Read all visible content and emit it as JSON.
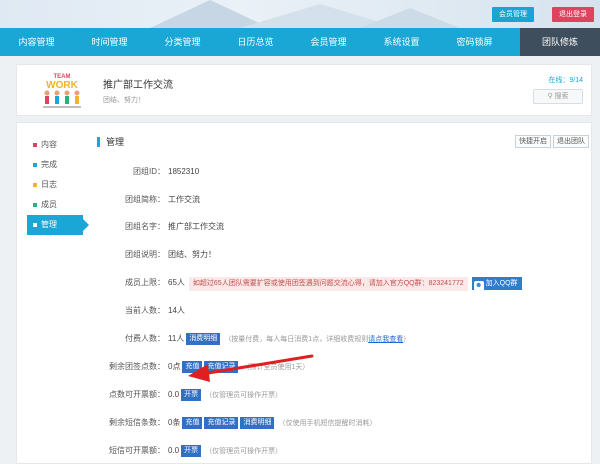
{
  "top_buttons": {
    "member_mgmt": "会员管理",
    "logout": "退出登录"
  },
  "nav": [
    "内容管理",
    "时间管理",
    "分类管理",
    "日历总览",
    "会员管理",
    "系统设置",
    "密码锁屏",
    "团队修炼"
  ],
  "header": {
    "logo_text_top": "TEAM",
    "logo_text_main": "WORK",
    "title": "推广部工作交流",
    "slogan": "团结、努力！",
    "online_label": "在线：",
    "online_count": "9/14",
    "search_label": "搜索"
  },
  "sidebar": [
    {
      "label": "内容",
      "color": "#e0435f"
    },
    {
      "label": "完成",
      "color": "#1aa7d5"
    },
    {
      "label": "日志",
      "color": "#f3b32c"
    },
    {
      "label": "成员",
      "color": "#2cb07a"
    },
    {
      "label": "管理",
      "color": "#ffffff"
    }
  ],
  "section": {
    "title": "管理",
    "shortcut_btn": "快捷开启",
    "quit_btn": "退出团队"
  },
  "fields": {
    "team_id_label": "团组ID：",
    "team_id": "1852310",
    "short_name_label": "团组简称：",
    "short_name": "工作交流",
    "name_label": "团组名字：",
    "name": "推广部工作交流",
    "desc_label": "团组说明：",
    "desc": "团结、努力！",
    "limit_label": "成员上限：",
    "limit": "65人",
    "limit_notice": "如超过65人团队需要扩容或使用团签遇到问题交流心得，请加入官方QQ群：823241772",
    "qq_btn": "加入QQ群",
    "current_label": "当前人数：",
    "current": "14人",
    "paid_label": "付费人数：",
    "paid": "11人",
    "paid_tag": "消费明细",
    "paid_hint": "（按量付费，每人每日消费1点，详细收费规则",
    "paid_link": "请点我查看",
    "paid_hint_end": "）",
    "points_label": "剩余团签点数：",
    "points": "0点",
    "points_tag1": "充值",
    "points_tag2": "充值记录",
    "points_hint": "（预计全员使用1天）",
    "tickets_label": "点数可开票额：",
    "tickets": "0.0",
    "tickets_tag": "开票",
    "tickets_hint": "（仅管理员可操作开票）",
    "sms_label": "剩余短信条数：",
    "sms": "0条",
    "sms_tag1": "充值",
    "sms_tag2": "充值记录",
    "sms_tag3": "消费明细",
    "sms_hint": "（仅使用手机短信提醒时消耗）",
    "sms_tickets_label": "短信可开票额：",
    "sms_tickets": "0.0",
    "sms_tickets_tag": "开票",
    "sms_tickets_hint": "（仅管理员可操作开票）"
  },
  "colors": {
    "accent": "#1aa7d5",
    "nav_active": "#3f4e5c",
    "logout": "#e0435f",
    "tag": "#3071c5",
    "arrow": "#e02020"
  }
}
